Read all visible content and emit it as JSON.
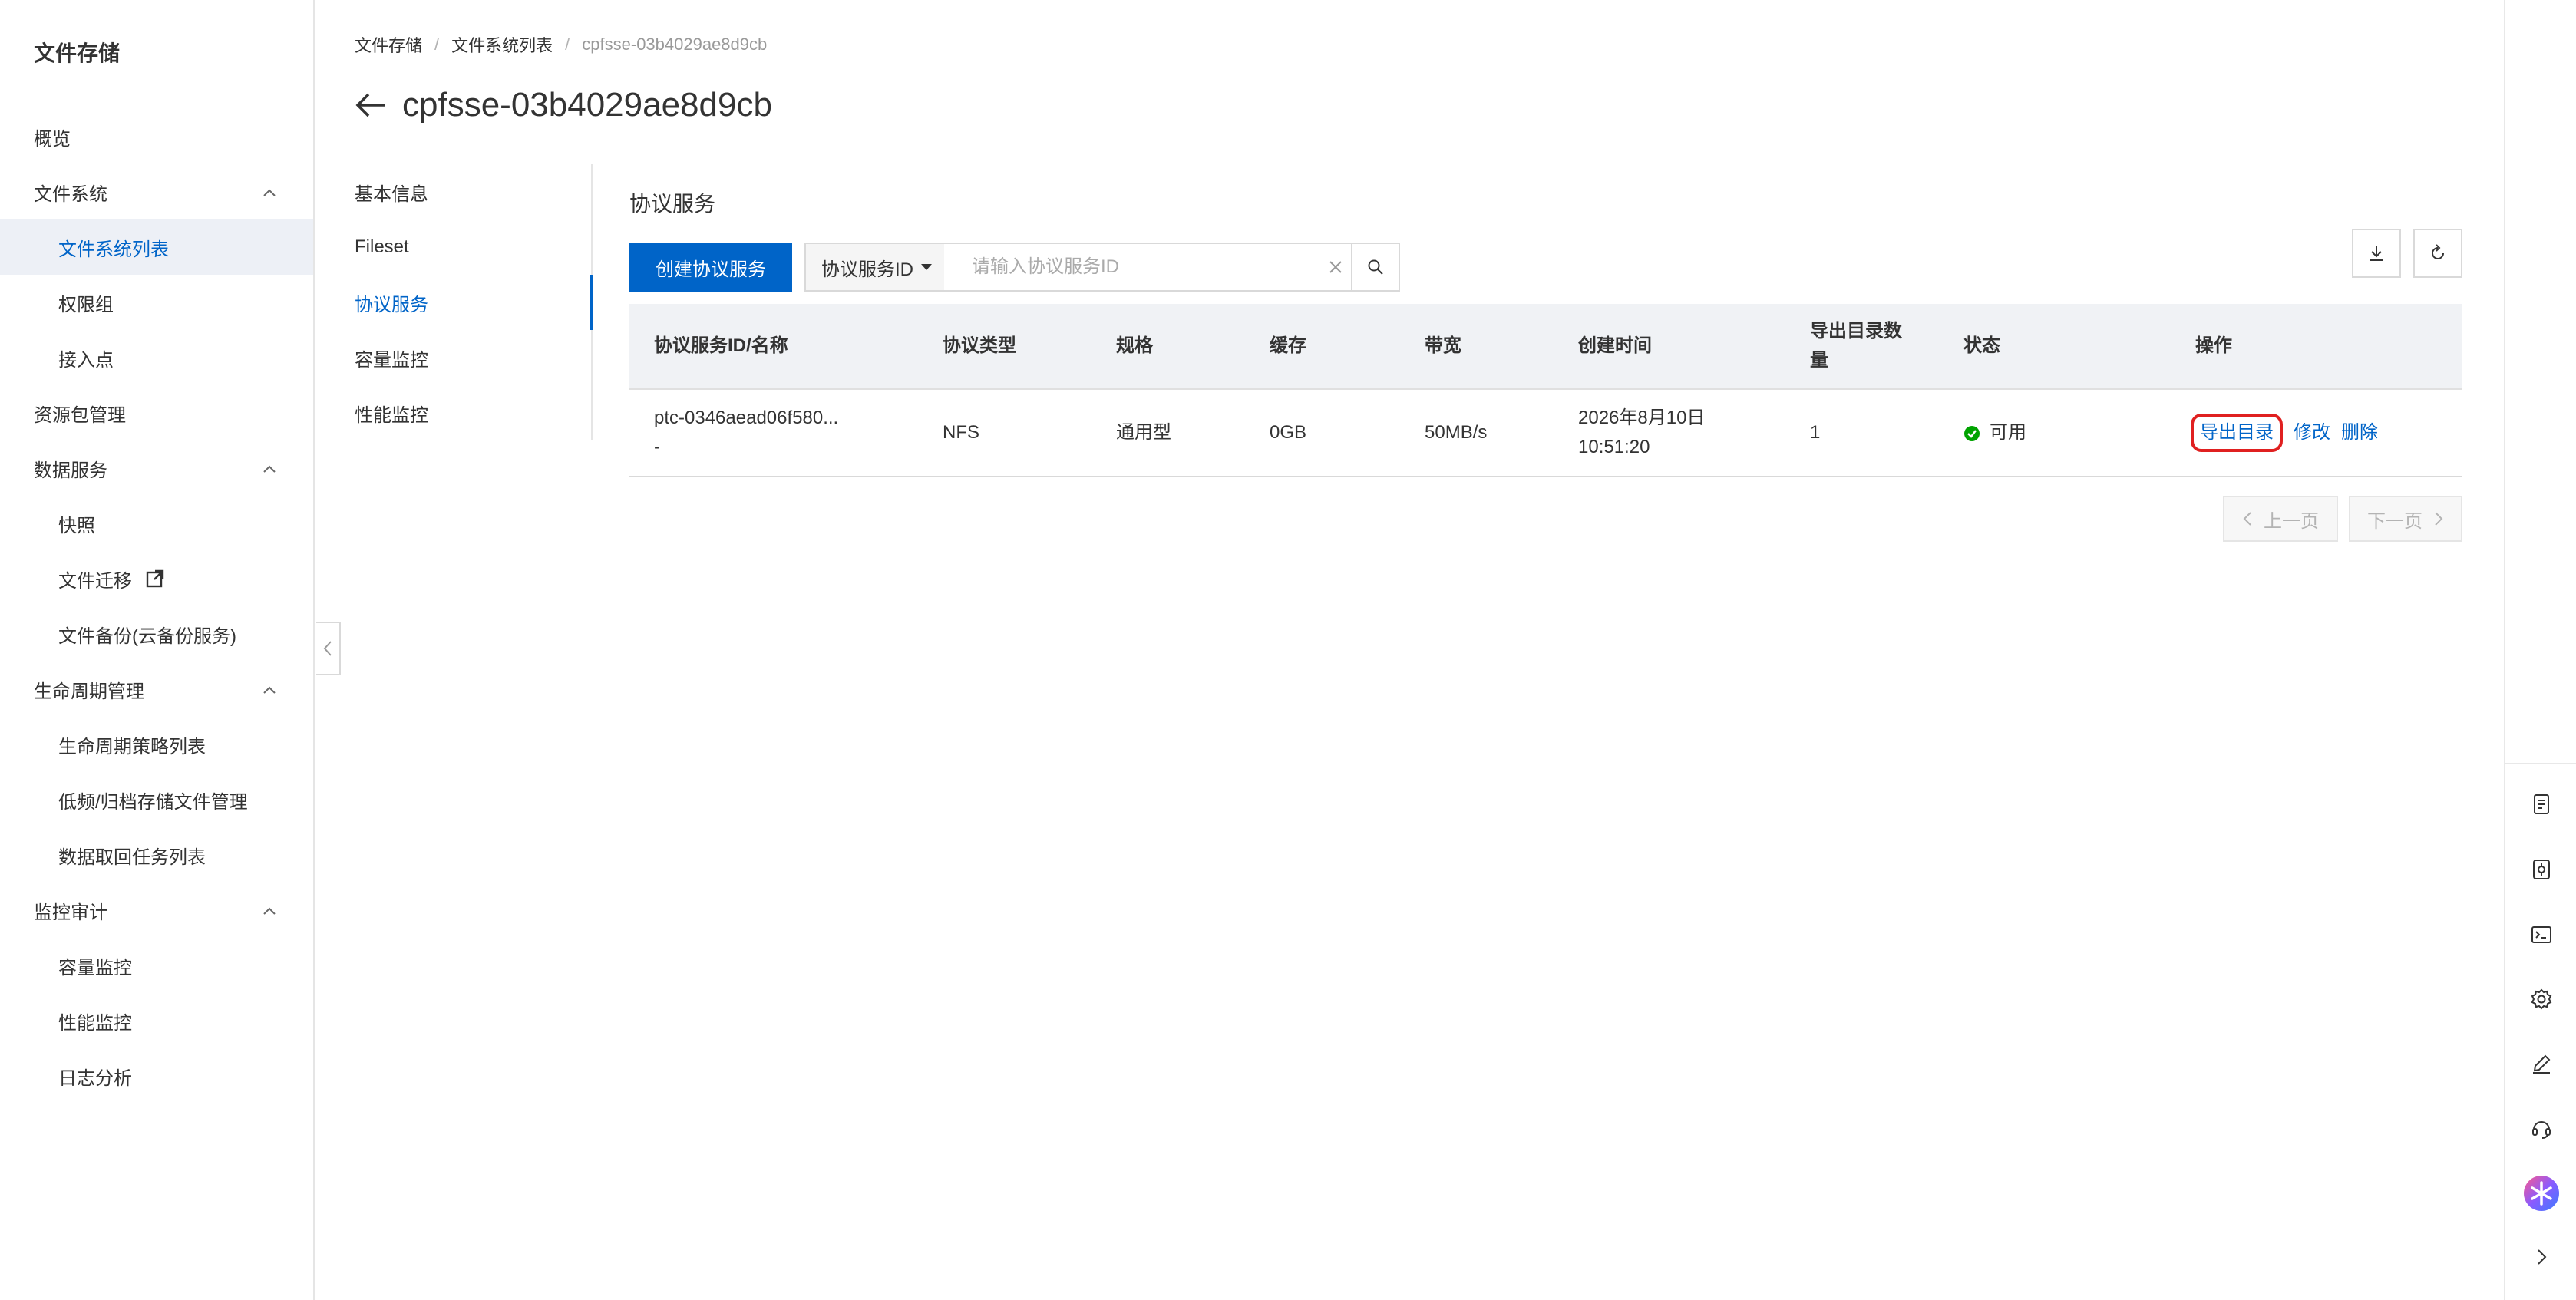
{
  "sidebar": {
    "title": "文件存储",
    "items": [
      {
        "label": "概览"
      },
      {
        "label": "文件系统"
      },
      {
        "label": "文件系统列表"
      },
      {
        "label": "权限组"
      },
      {
        "label": "接入点"
      },
      {
        "label": "资源包管理"
      },
      {
        "label": "数据服务"
      },
      {
        "label": "快照"
      },
      {
        "label": "文件迁移"
      },
      {
        "label": "文件备份(云备份服务)"
      },
      {
        "label": "生命周期管理"
      },
      {
        "label": "生命周期策略列表"
      },
      {
        "label": "低频/归档存储文件管理"
      },
      {
        "label": "数据取回任务列表"
      },
      {
        "label": "监控审计"
      },
      {
        "label": "容量监控"
      },
      {
        "label": "性能监控"
      },
      {
        "label": "日志分析"
      }
    ]
  },
  "breadcrumb": {
    "items": [
      "文件存储",
      "文件系统列表",
      "cpfsse-03b4029ae8d9cb"
    ]
  },
  "page": {
    "title": "cpfsse-03b4029ae8d9cb"
  },
  "subnav": {
    "items": [
      "基本信息",
      "Fileset",
      "协议服务",
      "容量监控",
      "性能监控"
    ]
  },
  "content": {
    "section_title": "协议服务",
    "create_button": "创建协议服务",
    "search": {
      "filter_label": "协议服务ID",
      "placeholder": "请输入协议服务ID"
    }
  },
  "table": {
    "columns": [
      "协议服务ID/名称",
      "协议类型",
      "规格",
      "缓存",
      "带宽",
      "创建时间",
      "导出目录数量",
      "状态",
      "操作"
    ],
    "rows": [
      {
        "id": "ptc-0346aead06f580...",
        "name": "-",
        "protocol": "NFS",
        "spec": "通用型",
        "cache": "0GB",
        "bandwidth": "50MB/s",
        "created_date": "2026年8月10日",
        "created_time": "10:51:20",
        "export_count": "1",
        "status": "可用",
        "actions": [
          "导出目录",
          "修改",
          "删除"
        ]
      }
    ]
  },
  "pagination": {
    "prev": "上一页",
    "next": "下一页"
  },
  "colors": {
    "primary": "#0064c8",
    "status_ok": "#00a300",
    "highlight": "#e02020"
  }
}
